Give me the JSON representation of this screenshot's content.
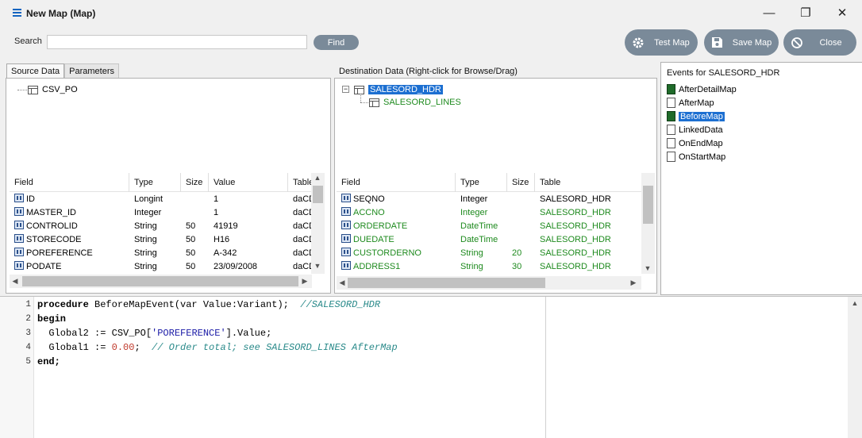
{
  "window": {
    "title": "New Map (Map)",
    "minimize": "—",
    "restore": "❐",
    "close": "✕"
  },
  "toolbar": {
    "search_label": "Search",
    "search_value": "",
    "find_label": "Find",
    "test_map_label": "Test Map",
    "save_map_label": "Save Map",
    "close_label": "Close"
  },
  "source": {
    "tabs": [
      "Source Data",
      "Parameters"
    ],
    "tree_root": "CSV_PO",
    "columns": [
      "Field",
      "Type",
      "Size",
      "Value",
      "Table"
    ],
    "rows": [
      {
        "field": "ID",
        "type": "Longint",
        "size": "",
        "value": "1",
        "table": "daCD"
      },
      {
        "field": "MASTER_ID",
        "type": "Integer",
        "size": "",
        "value": "1",
        "table": "daCD"
      },
      {
        "field": "CONTROLID",
        "type": "String",
        "size": "50",
        "value": "41919",
        "table": "daCD"
      },
      {
        "field": "STORECODE",
        "type": "String",
        "size": "50",
        "value": "H16",
        "table": "daCD"
      },
      {
        "field": "POREFERENCE",
        "type": "String",
        "size": "50",
        "value": "A-342",
        "table": "daCD"
      },
      {
        "field": "PODATE",
        "type": "String",
        "size": "50",
        "value": "23/09/2008",
        "table": "daCD"
      }
    ]
  },
  "destination": {
    "title": "Destination Data  (Right-click for Browse/Drag)",
    "tree_root": "SALESORD_HDR",
    "tree_child": "SALESORD_LINES",
    "expander": "−",
    "columns": [
      "Field",
      "Type",
      "Size",
      "Table"
    ],
    "rows": [
      {
        "field": "SEQNO",
        "type": "Integer",
        "size": "",
        "table": "SALESORD_HDR",
        "mapped": false
      },
      {
        "field": "ACCNO",
        "type": "Integer",
        "size": "",
        "table": "SALESORD_HDR",
        "mapped": true
      },
      {
        "field": "ORDERDATE",
        "type": "DateTime",
        "size": "",
        "table": "SALESORD_HDR",
        "mapped": true
      },
      {
        "field": "DUEDATE",
        "type": "DateTime",
        "size": "",
        "table": "SALESORD_HDR",
        "mapped": true
      },
      {
        "field": "CUSTORDERNO",
        "type": "String",
        "size": "20",
        "table": "SALESORD_HDR",
        "mapped": true
      },
      {
        "field": "ADDRESS1",
        "type": "String",
        "size": "30",
        "table": "SALESORD_HDR",
        "mapped": true
      }
    ]
  },
  "events": {
    "title": "Events for SALESORD_HDR",
    "items": [
      {
        "label": "AfterDetailMap",
        "filled": true,
        "selected": false
      },
      {
        "label": "AfterMap",
        "filled": false,
        "selected": false
      },
      {
        "label": "BeforeMap",
        "filled": true,
        "selected": true
      },
      {
        "label": "LinkedData",
        "filled": false,
        "selected": false
      },
      {
        "label": "OnEndMap",
        "filled": false,
        "selected": false
      },
      {
        "label": "OnStartMap",
        "filled": false,
        "selected": false
      }
    ]
  },
  "editor": {
    "line_numbers": [
      "1",
      "2",
      "3",
      "4",
      "5"
    ],
    "l1_kw": "procedure",
    "l1_code": " BeforeMapEvent(var Value:Variant);  ",
    "l1_comment": "//SALESORD_HDR",
    "l2_kw": "begin",
    "l3_a": "  Global2 := CSV_PO[",
    "l3_str": "'POREFERENCE'",
    "l3_b": "].Value;",
    "l4_a": "  Global1 := ",
    "l4_num": "0.00",
    "l4_b": ";  ",
    "l4_comment": "// Order total; see SALESORD_LINES AfterMap",
    "l5_kw": "end;"
  }
}
